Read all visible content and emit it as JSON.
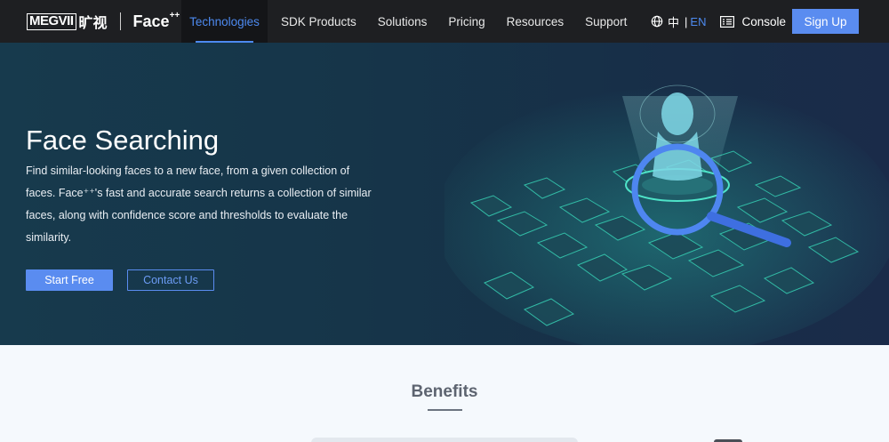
{
  "brand": {
    "megvii": "MEGVII",
    "cn": "旷视",
    "face": "Face",
    "face_sup": "++"
  },
  "nav": {
    "items": [
      {
        "label": "Technologies",
        "active": true
      },
      {
        "label": "SDK Products"
      },
      {
        "label": "Solutions"
      },
      {
        "label": "Pricing"
      },
      {
        "label": "Resources"
      },
      {
        "label": "Support"
      }
    ],
    "lang_cn": "中",
    "lang_sep": "|",
    "lang_en": "EN",
    "console": "Console",
    "signup": "Sign Up"
  },
  "hero": {
    "title": "Face Searching",
    "description": "Find similar-looking faces to a new face, from a given collection of faces. Face⁺⁺'s fast and accurate search returns a collection of similar faces, along with confidence score and thresholds to evaluate the similarity.",
    "start_free": "Start Free",
    "contact_us": "Contact Us"
  },
  "benefits": {
    "title": "Benefits"
  },
  "colors": {
    "accent": "#5a8cf0",
    "nav_bg": "#1e1f22",
    "hero_bg": "#173a4d",
    "active_text": "#4d8af0"
  },
  "icons": [
    "globe-icon",
    "console-icon"
  ]
}
